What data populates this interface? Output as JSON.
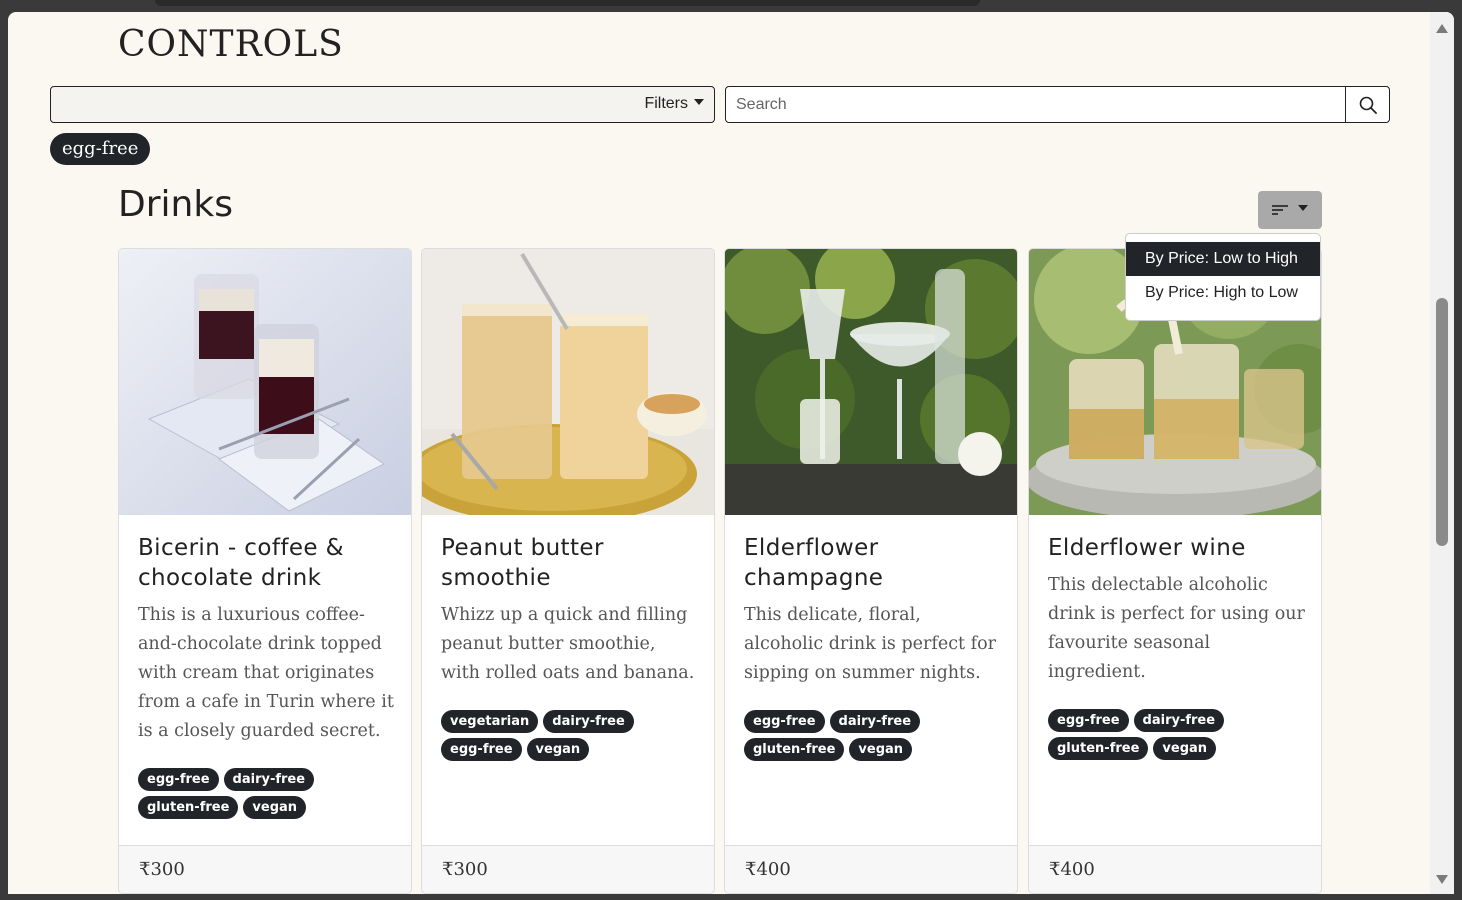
{
  "header": {
    "title": "CONTROLS"
  },
  "filters": {
    "label": "Filters",
    "active_chip": "egg-free"
  },
  "search": {
    "placeholder": "Search"
  },
  "section": {
    "title": "Drinks"
  },
  "sort": {
    "options": [
      "By Price: Low to High",
      "By Price: High to Low"
    ],
    "selected": "By Price: Low to High"
  },
  "cards": [
    {
      "title": "Bicerin - coffee & chocolate drink",
      "description": "This is a luxurious coffee-and-chocolate drink topped with cream that originates from a cafe in Turin where it is a closely guarded secret.",
      "tags": [
        "egg-free",
        "dairy-free",
        "gluten-free",
        "vegan"
      ],
      "price": "₹300"
    },
    {
      "title": "Peanut butter smoothie",
      "description": "Whizz up a quick and filling peanut butter smoothie, with rolled oats and banana.",
      "tags": [
        "vegetarian",
        "dairy-free",
        "egg-free",
        "vegan"
      ],
      "price": "₹300"
    },
    {
      "title": "Elderflower champagne",
      "description": "This delicate, floral, alcoholic drink is perfect for sipping on summer nights.",
      "tags": [
        "egg-free",
        "dairy-free",
        "gluten-free",
        "vegan"
      ],
      "price": "₹400"
    },
    {
      "title": "Elderflower wine",
      "description": "This delectable alcoholic drink is perfect for using our favourite seasonal ingredient.",
      "tags": [
        "egg-free",
        "dairy-free",
        "gluten-free",
        "vegan"
      ],
      "price": "₹400"
    }
  ],
  "colors": {
    "accent": "#212529",
    "background": "#fbf7f1",
    "sort_button": "#a9a9a9"
  }
}
